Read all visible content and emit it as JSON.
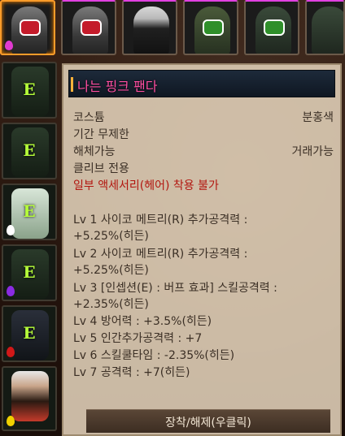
{
  "tooltip": {
    "title": "나는 핑크 팬다",
    "item_type": "코스튬",
    "item_grade": "분홍색",
    "duration": "기간 무제한",
    "disassemble": "해체가능",
    "trade": "거래가능",
    "class_only": "클리브 전용",
    "restriction": "일부 액세서리(헤어) 착용 불가",
    "stats": [
      "Lv 1 사이코 메트리(R) 추가공격력 :",
      "+5.25%(히든)",
      "Lv 2 사이코 메트리(R) 추가공격력 :",
      "+5.25%(히든)",
      "Lv 3 [인셉션(E) : 버프 효과] 스킬공격력 :",
      "+2.35%(히든)",
      "Lv 4 방어력 : +3.5%(히든)",
      "Lv 5 인간추가공격력 : +7",
      "Lv 6 스킬쿨타임 : -2.35%(히든)",
      "Lv 7 공격력 : +7(히든)"
    ],
    "action": "장착/해제(우클릭)"
  },
  "left_slots": [
    {
      "label": "E",
      "drop": ""
    },
    {
      "label": "E",
      "drop": ""
    },
    {
      "label": "E",
      "drop": "#ffffff"
    },
    {
      "label": "E",
      "drop": "#8a2be2"
    },
    {
      "label": "E",
      "drop": "#d01818"
    },
    {
      "label": "",
      "drop": "#f0d000"
    }
  ],
  "colors": {
    "title_text": "#ff4fa3",
    "warning_text": "#b2160f",
    "selected_border": "#ff9c2a",
    "slot_letter": "#b6ff3a"
  }
}
